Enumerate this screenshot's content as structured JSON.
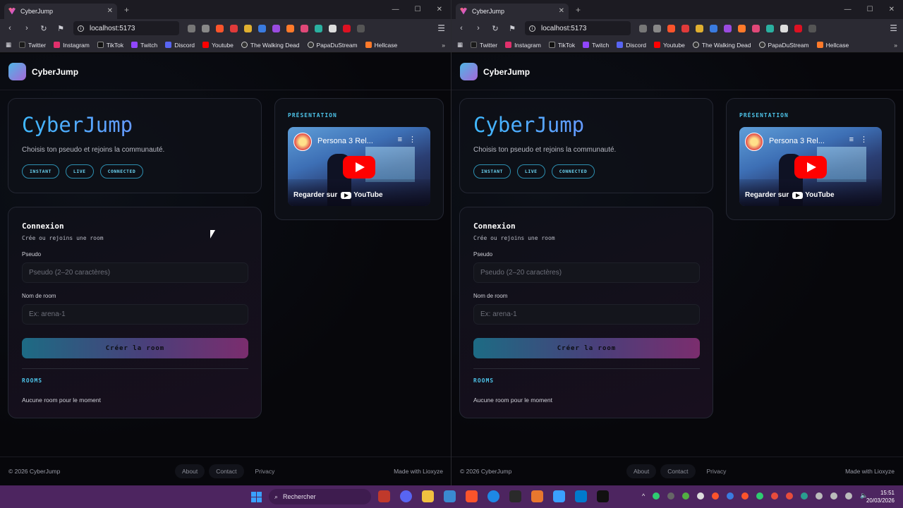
{
  "browser": {
    "tab_title": "CyberJump",
    "url": "localhost:5173",
    "new_tab_symbol": "+",
    "bookmarks": [
      {
        "label": "Twitter",
        "color": "#1a1a1a"
      },
      {
        "label": "Instagram",
        "color": "#e1306c"
      },
      {
        "label": "TikTok",
        "color": "#111111"
      },
      {
        "label": "Twitch",
        "color": "#9146ff"
      },
      {
        "label": "Discord",
        "color": "#5865f2"
      },
      {
        "label": "Youtube",
        "color": "#ff0000"
      },
      {
        "label": "The Walking Dead",
        "color": "#c8c8c8"
      },
      {
        "label": "PapaDuStream",
        "color": "#d0d0d0"
      },
      {
        "label": "Hellcase",
        "color": "#ff7a2a"
      }
    ]
  },
  "app": {
    "brand": "CyberJump",
    "hero": {
      "title": "CyberJump",
      "subtitle": "Choisis ton pseudo et rejoins la communauté.",
      "chips": [
        "INSTANT",
        "LIVE",
        "CONNECTED"
      ]
    },
    "presentation": {
      "label": "PRÉSENTATION",
      "video_title": "Persona 3 Rel...",
      "watch_on": "Regarder sur",
      "platform": "YouTube"
    },
    "login": {
      "title": "Connexion",
      "subtitle": "Crée ou rejoins une room",
      "pseudo_label": "Pseudo",
      "pseudo_placeholder": "Pseudo (2–20 caractères)",
      "room_label": "Nom de room",
      "room_placeholder": "Ex: arena-1",
      "create_button": "Créer la room",
      "rooms_label": "ROOMS",
      "rooms_empty": "Aucune room pour le moment"
    },
    "footer": {
      "copyright": "© 2026 CyberJump",
      "links": [
        "About",
        "Contact",
        "Privacy"
      ],
      "made_with": "Made with Lioxyze"
    }
  },
  "taskbar": {
    "search_placeholder": "Rechercher",
    "time": "15:51",
    "date": "20/03/2026"
  },
  "colors": {
    "accent_cyan": "#4dc3e8",
    "brand_gradient_start": "#3fb8ff",
    "brand_gradient_end": "#8c7cff",
    "taskbar": "#4d2560"
  }
}
